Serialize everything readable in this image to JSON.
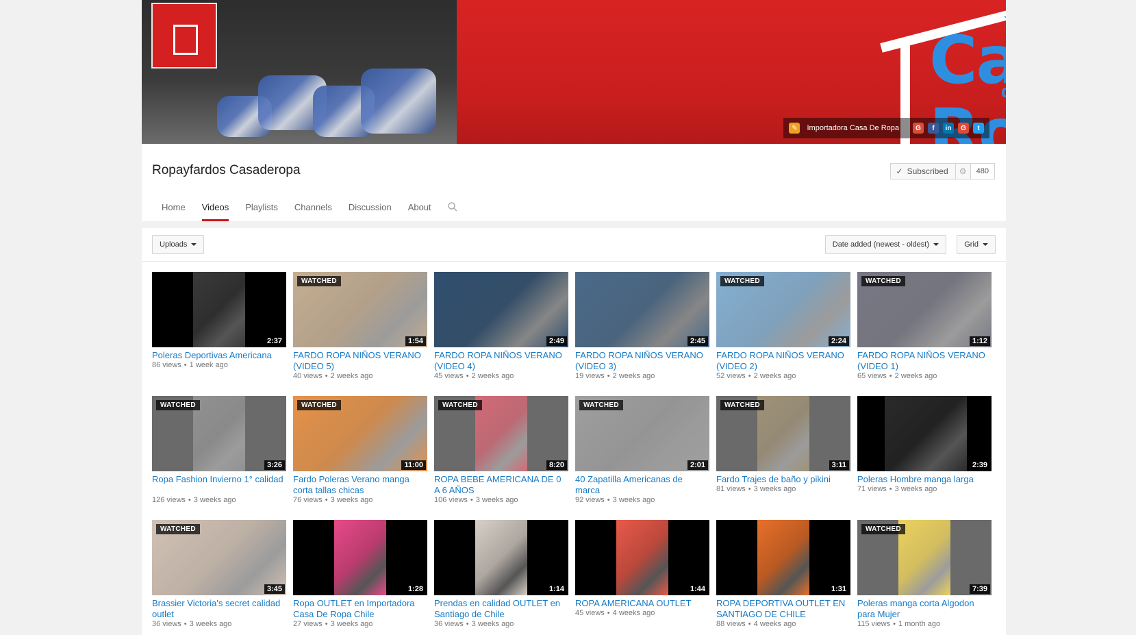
{
  "banner": {
    "sign_text": "CASA DE ROPA",
    "logo_line1": "Casa",
    "logo_line2": "de",
    "logo_line3": "Ropa",
    "link_label": "Importadora Casa De Ropa",
    "social_icons": [
      "google-plus-icon",
      "facebook-icon",
      "linkedin-icon",
      "google-plus-icon",
      "twitter-icon"
    ]
  },
  "channel": {
    "name": "Ropayfardos Casaderopa",
    "subscribe_label": "Subscribed",
    "subscriber_count": "480"
  },
  "tabs": [
    {
      "label": "Home",
      "active": false
    },
    {
      "label": "Videos",
      "active": true
    },
    {
      "label": "Playlists",
      "active": false
    },
    {
      "label": "Channels",
      "active": false
    },
    {
      "label": "Discussion",
      "active": false
    },
    {
      "label": "About",
      "active": false
    }
  ],
  "toolbar": {
    "uploads_label": "Uploads",
    "sort_label": "Date added (newest - oldest)",
    "view_label": "Grid"
  },
  "watched_label": "WATCHED",
  "videos": [
    {
      "title": "Poleras Deportivas Americana",
      "views": "86 views",
      "age": "1 week ago",
      "duration": "2:37",
      "watched": false,
      "thumb": "#3a3a3a"
    },
    {
      "title": "FARDO ROPA NIÑOS VERANO (VIDEO 5)",
      "views": "40 views",
      "age": "2 weeks ago",
      "duration": "1:54",
      "watched": true,
      "thumb": "#b89c7a"
    },
    {
      "title": "FARDO ROPA NIÑOS VERANO (VIDEO 4)",
      "views": "45 views",
      "age": "2 weeks ago",
      "duration": "2:49",
      "watched": false,
      "thumb": "#2f4f6f"
    },
    {
      "title": "FARDO ROPA NIÑOS VERANO (VIDEO 3)",
      "views": "19 views",
      "age": "2 weeks ago",
      "duration": "2:45",
      "watched": false,
      "thumb": "#4a6a8a"
    },
    {
      "title": "FARDO ROPA NIÑOS VERANO (VIDEO 2)",
      "views": "52 views",
      "age": "2 weeks ago",
      "duration": "2:24",
      "watched": true,
      "thumb": "#6a9ec8"
    },
    {
      "title": "FARDO ROPA NIÑOS VERANO (VIDEO 1)",
      "views": "65 views",
      "age": "2 weeks ago",
      "duration": "1:12",
      "watched": true,
      "thumb": "#5a5a6a"
    },
    {
      "title": "Ropa Fashion Invierno 1° calidad",
      "views": "126 views",
      "age": "3 weeks ago",
      "duration": "3:26",
      "watched": true,
      "thumb": "#7a7a7a"
    },
    {
      "title": "Fardo Poleras Verano manga corta tallas chicas",
      "views": "76 views",
      "age": "3 weeks ago",
      "duration": "11:00",
      "watched": true,
      "thumb": "#e07a20"
    },
    {
      "title": "ROPA BEBE AMERICANA DE 0 A 6 AÑOS",
      "views": "106 views",
      "age": "3 weeks ago",
      "duration": "8:20",
      "watched": true,
      "thumb": "#c84a5a"
    },
    {
      "title": "40 Zapatilla Americanas de marca",
      "views": "92 views",
      "age": "3 weeks ago",
      "duration": "2:01",
      "watched": true,
      "thumb": "#8a8a8a"
    },
    {
      "title": "Fardo Trajes de baño y pikini",
      "views": "81 views",
      "age": "3 weeks ago",
      "duration": "3:11",
      "watched": true,
      "thumb": "#8a7a5a"
    },
    {
      "title": "Poleras Hombre manga larga",
      "views": "71 views",
      "age": "3 weeks ago",
      "duration": "2:39",
      "watched": false,
      "thumb": "#2a2a2a"
    },
    {
      "title": "Brassier Victoria's secret calidad outlet",
      "views": "36 views",
      "age": "3 weeks ago",
      "duration": "3:45",
      "watched": true,
      "thumb": "#c8b4a4"
    },
    {
      "title": "Ropa OUTLET en Importadora Casa De Ropa Chile",
      "views": "27 views",
      "age": "3 weeks ago",
      "duration": "1:28",
      "watched": false,
      "thumb": "#e84a8a"
    },
    {
      "title": "Prendas en calidad OUTLET en Santiago de Chile",
      "views": "36 views",
      "age": "3 weeks ago",
      "duration": "1:14",
      "watched": false,
      "thumb": "#d8d0c8"
    },
    {
      "title": "ROPA AMERICANA OUTLET",
      "views": "45 views",
      "age": "4 weeks ago",
      "duration": "1:44",
      "watched": false,
      "thumb": "#e85a4a"
    },
    {
      "title": "ROPA DEPORTIVA OUTLET EN SANTIAGO DE CHILE",
      "views": "88 views",
      "age": "4 weeks ago",
      "duration": "1:31",
      "watched": false,
      "thumb": "#e8702a"
    },
    {
      "title": "Poleras manga corta Algodon para Mujer",
      "views": "115 views",
      "age": "1 month ago",
      "duration": "7:39",
      "watched": true,
      "thumb": "#e8c83a"
    }
  ]
}
